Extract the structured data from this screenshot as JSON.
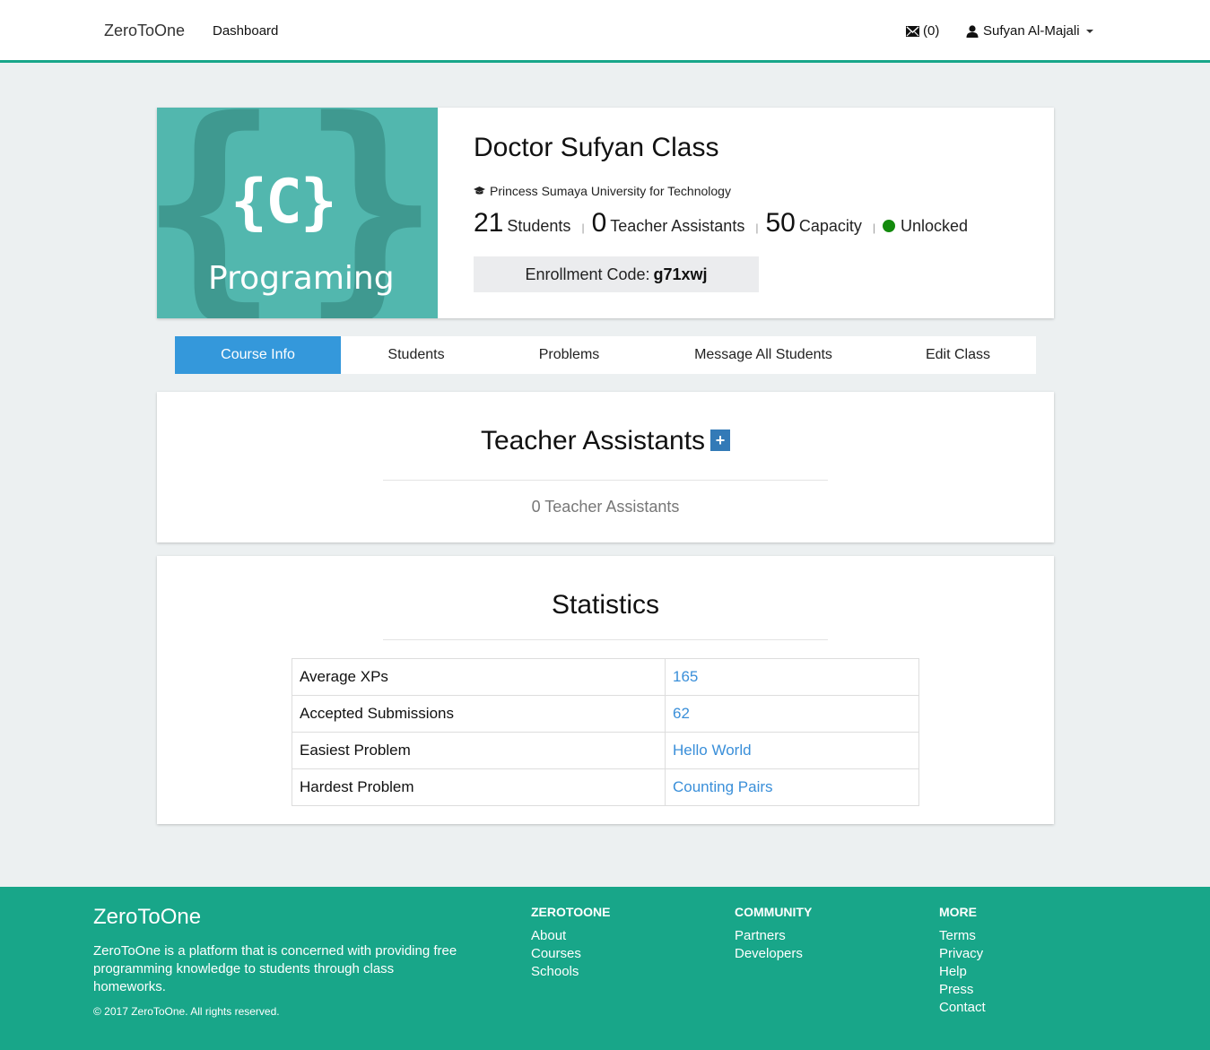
{
  "navbar": {
    "brand": "ZeroToOne",
    "dashboard": "Dashboard",
    "messages_count": "(0)",
    "user_name": "Sufyan Al-Majali"
  },
  "course": {
    "image_symbol": "{C}",
    "image_text": "Programing",
    "title": "Doctor Sufyan Class",
    "university": "Princess Sumaya University for Technology",
    "students_count": "21",
    "students_label": "Students",
    "tas_count": "0",
    "tas_label": "Teacher Assistants",
    "capacity_count": "50",
    "capacity_label": "Capacity",
    "status": "Unlocked",
    "separator": "|",
    "enroll_label": "Enrollment Code:",
    "enroll_code": "g71xwj"
  },
  "tabs": [
    {
      "label": "Course Info",
      "active": true
    },
    {
      "label": "Students"
    },
    {
      "label": "Problems"
    },
    {
      "label": "Message All Students"
    },
    {
      "label": "Edit Class"
    }
  ],
  "teacher_assistants": {
    "title": "Teacher Assistants",
    "add_symbol": "+",
    "empty_text": "0 Teacher Assistants"
  },
  "statistics": {
    "title": "Statistics",
    "rows": [
      {
        "label": "Average XPs",
        "value": "165"
      },
      {
        "label": "Accepted Submissions",
        "value": "62"
      },
      {
        "label": "Easiest Problem",
        "value": "Hello World"
      },
      {
        "label": "Hardest Problem",
        "value": "Counting Pairs"
      }
    ]
  },
  "footer": {
    "brand": "ZeroToOne",
    "description": "ZeroToOne is a platform that is concerned with providing free programming knowledge to students through class homeworks.",
    "copyright": "© 2017 ZeroToOne. All rights reserved.",
    "columns": [
      {
        "heading": "ZEROTOONE",
        "links": [
          "About",
          "Courses",
          "Schools"
        ]
      },
      {
        "heading": "COMMUNITY",
        "links": [
          "Partners",
          "Developers"
        ]
      },
      {
        "heading": "MORE",
        "links": [
          "Terms",
          "Privacy",
          "Help",
          "Press",
          "Contact"
        ]
      }
    ]
  },
  "colors": {
    "accent": "#18a689",
    "tab_active": "#3498db",
    "link": "#3a8fd9",
    "status_dot": "#138a0d",
    "image_bg": "#52b7ae"
  }
}
